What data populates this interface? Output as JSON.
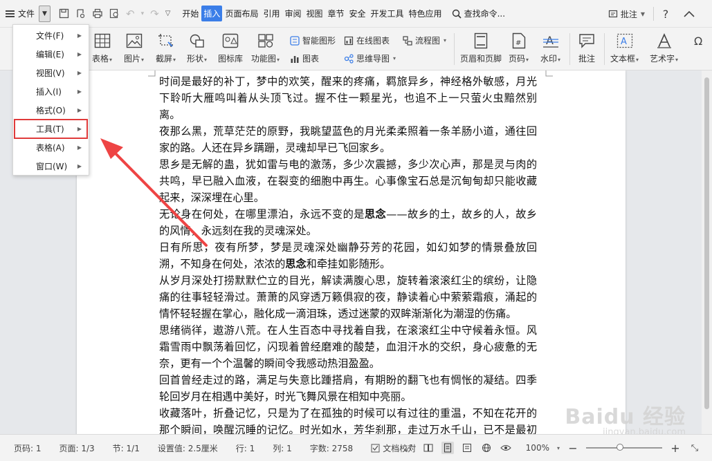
{
  "menubar": {
    "file_label": "文件",
    "tabs": [
      "开始",
      "插入",
      "页面布局",
      "引用",
      "审阅",
      "视图",
      "章节",
      "安全",
      "开发工具",
      "特色应用"
    ],
    "active_tab": "插入",
    "search_label": "查找命令...",
    "comment_label": "批注",
    "help_label": "?"
  },
  "ribbon": {
    "table": "表格",
    "picture": "图片",
    "screenshot": "截屏",
    "shape": "形状",
    "icon_lib": "图标库",
    "func_chart": "功能图",
    "smart_shape": "智能图形",
    "chart": "图表",
    "online_chart": "在线图表",
    "mind_map": "思维导图",
    "flowchart": "流程图",
    "header_footer": "页眉和页脚",
    "page_number": "页码",
    "watermark": "水印",
    "comment": "批注",
    "text_box": "文本框",
    "art_text": "艺术字"
  },
  "dropdown": {
    "items": [
      {
        "label": "文件(F)"
      },
      {
        "label": "编辑(E)"
      },
      {
        "label": "视图(V)"
      },
      {
        "label": "插入(I)"
      },
      {
        "label": "格式(O)"
      },
      {
        "label": "工具(T)"
      },
      {
        "label": "表格(A)"
      },
      {
        "label": "窗口(W)"
      }
    ],
    "highlighted": "工具(T)",
    "highlight_color": "#e03a3a"
  },
  "document": {
    "paragraphs": [
      "时间是最好的补丁，梦中的欢笑，醒来的疼痛，羁旅异乡，神经格外敏感，月光下聆听大雁鸣叫着从头顶飞过。握不住一颗星光，也追不上一只萤火虫黯然别离。",
      "夜那么黑，荒草茫茫的原野，我眺望蓝色的月光柔柔照着一条羊肠小道，通往回家的路。人还在异乡蹒跚，灵魂却早已飞回家乡。",
      "思乡是无解的蛊，犹如雷与电的激荡，多少次震撼，多少次心声，那是灵与肉的共鸣，早已融入血液，在裂变的细胞中再生。心事像宝石总是沉甸甸却只能收藏起来，深深埋在心里。",
      "无论身在何处，在哪里漂泊，永远不变的是",
      "思念",
      "——故乡的土，故乡的人，故乡的风情，永远刻在我的灵魂深处。",
      "日有所思，夜有所梦，梦是灵魂深处幽静芬芳的花园，如幻如梦的情景叠放回溯，不知身在何处，浓浓的",
      "思念",
      "和牵挂如影随形。",
      "从岁月深处打捞默默伫立的目光，解读满腹心思，旋转着滚滚红尘的缤纷，让隐痛的往事轻轻滑过。萧萧的风穿透万籁俱寂的夜，静读着心中萦萦霜痕，涌起的情怀轻轻握在掌心，融化成一滴泪珠，透过迷蒙的双眸渐渐化为潮湿的伤痛。",
      "思绪徜徉，遨游八荒。在人生百态中寻找着自我，在滚滚红尘中守候着永恒。风霜雪雨中飘荡着回忆，闪现着曾经磨难的酸楚，血泪汗水的交织，身心疲惫的无奈，更有一个个温馨的瞬间令我感动热泪盈盈。",
      "回首曾经走过的路，满足与失意比踵搭肩，有期盼的翻飞也有惆怅的凝结。四季轮回岁月在相遇中美好，时光飞舞风景在相知中亮丽。",
      "收藏落叶，折叠记忆，只是为了在孤独的时候可以有过往的重温，不知在花开的那个瞬间，唤醒沉睡的记忆。时光如水，芳华刹那，走过万水千山，已不是最初的自己，亦回不到最初的地方。只有心中的情愫还在以一种寂静安然的姿势，守候在时光彼岸。"
    ]
  },
  "statusbar": {
    "page_num": "页码: 1",
    "pages": "页面: 1/3",
    "section": "节: 1/1",
    "setting": "设置值: 2.5厘米",
    "row": "行: 1",
    "col": "列: 1",
    "word_count": "字数: 2758",
    "proofread": "文档校对",
    "zoom": "100%",
    "zoom_value": 100
  },
  "watermark_text": {
    "brand": "Baidu 经验",
    "url": "jingyan.baidu.com"
  }
}
